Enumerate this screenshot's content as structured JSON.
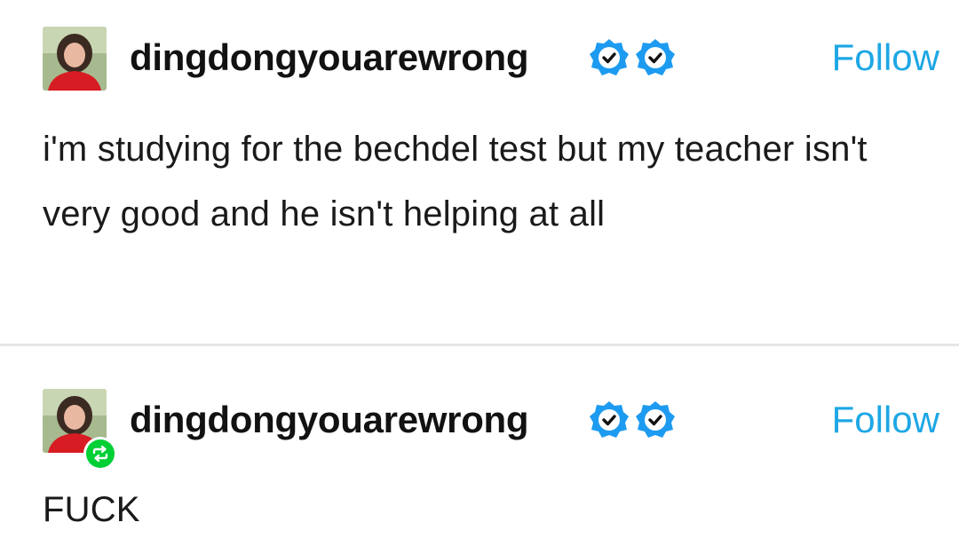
{
  "posts": [
    {
      "username": "dingdongyouarewrong",
      "follow_label": "Follow",
      "verified_badges": [
        "checkmark-badge-icon",
        "checkmark-badge-icon"
      ],
      "body": "i'm studying for the bechdel test but my teacher isn't very good and he isn't helping at all"
    },
    {
      "username": "dingdongyouarewrong",
      "follow_label": "Follow",
      "verified_badges": [
        "checkmark-badge-icon",
        "checkmark-badge-icon"
      ],
      "reblog_icon": "reblog-icon",
      "body": "FUCK"
    }
  ],
  "colors": {
    "follow": "#1ea7e4",
    "badge": "#1d9bf0",
    "reblog": "#00cf35"
  }
}
